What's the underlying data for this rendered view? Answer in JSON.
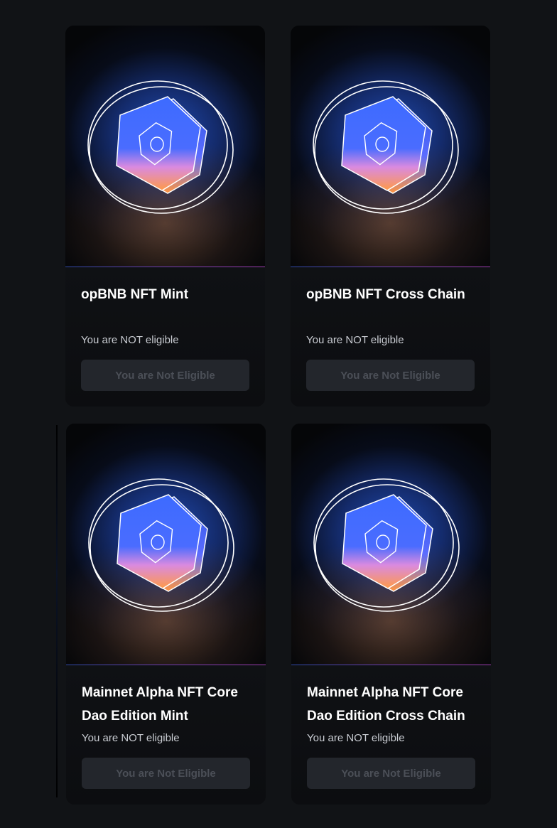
{
  "cards": [
    {
      "title": "opBNB NFT Mint",
      "status": "You are NOT eligible",
      "button_label": "You are Not Eligible",
      "icon": "nft-coin-icon"
    },
    {
      "title": "opBNB NFT Cross Chain",
      "status": "You are NOT eligible",
      "button_label": "You are Not Eligible",
      "icon": "nft-coin-icon"
    },
    {
      "title": "Mainnet Alpha NFT Core Dao Edition Mint",
      "status": "You are NOT eligible",
      "button_label": "You are Not Eligible",
      "icon": "nft-coin-icon"
    },
    {
      "title": "Mainnet Alpha NFT Core Dao Edition Cross Chain",
      "status": "You are NOT eligible",
      "button_label": "You are Not Eligible",
      "icon": "nft-coin-icon"
    }
  ],
  "colors": {
    "background": "#111316",
    "card_body": "#0f1114",
    "button_bg": "#23262c",
    "button_text": "#4b4f57",
    "accent_blue": "#3b6cff",
    "accent_orange": "#ff9a4a"
  }
}
